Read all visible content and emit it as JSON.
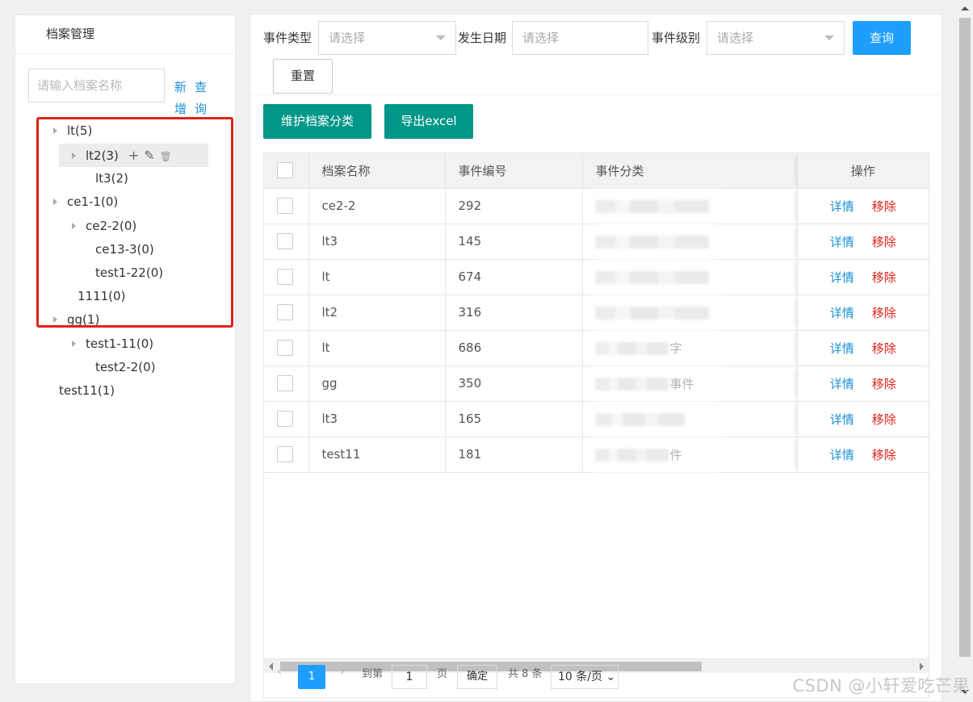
{
  "left_panel": {
    "title": "档案管理",
    "search_placeholder": "请输入档案名称",
    "new_label": "新增",
    "query_label": "查询"
  },
  "tree": [
    {
      "label": "lt(5)",
      "has_children": true
    },
    {
      "label": "lt2(3)",
      "has_children": true,
      "selected": true
    },
    {
      "label": "lt3(2)",
      "has_children": false
    },
    {
      "label": "ce1-1(0)",
      "has_children": true
    },
    {
      "label": "ce2-2(0)",
      "has_children": true
    },
    {
      "label": "ce13-3(0)",
      "has_children": false
    },
    {
      "label": "test1-22(0)",
      "has_children": false
    },
    {
      "label": "1111(0)",
      "has_children": false
    },
    {
      "label": "gg(1)",
      "has_children": true
    },
    {
      "label": "test1-11(0)",
      "has_children": true
    },
    {
      "label": "test2-2(0)",
      "has_children": false
    },
    {
      "label": "test11(1)",
      "has_children": false
    }
  ],
  "filters": {
    "event_type_label": "事件类型",
    "event_type_placeholder": "请选择",
    "date_label": "发生日期",
    "date_placeholder": "请选择",
    "level_label": "事件级别",
    "level_placeholder": "请选择",
    "query_button": "查询",
    "reset_button": "重置"
  },
  "actions": {
    "maintain_button": "维护档案分类",
    "export_button": "导出excel"
  },
  "table": {
    "columns": [
      "档案名称",
      "事件编号",
      "事件分类",
      "操作"
    ],
    "detail_label": "详情",
    "remove_label": "移除",
    "rows": [
      {
        "name": "ce2-2",
        "id": "292",
        "category": ""
      },
      {
        "name": "lt3",
        "id": "145",
        "category": ""
      },
      {
        "name": "lt",
        "id": "674",
        "category": ""
      },
      {
        "name": "lt2",
        "id": "316",
        "category": ""
      },
      {
        "name": "lt",
        "id": "686",
        "category": "字"
      },
      {
        "name": "gg",
        "id": "350",
        "category": "事件"
      },
      {
        "name": "lt3",
        "id": "165",
        "category": ""
      },
      {
        "name": "test11",
        "id": "181",
        "category": "件"
      }
    ]
  },
  "pager": {
    "prev": "‹",
    "current": "1",
    "next": "›",
    "goto_label": "到第",
    "goto_value": "1",
    "page_unit": "页",
    "confirm": "确定",
    "total": "共 8 条",
    "page_size": "10 条/页"
  },
  "watermark": "CSDN @小轩爱吃芒果"
}
